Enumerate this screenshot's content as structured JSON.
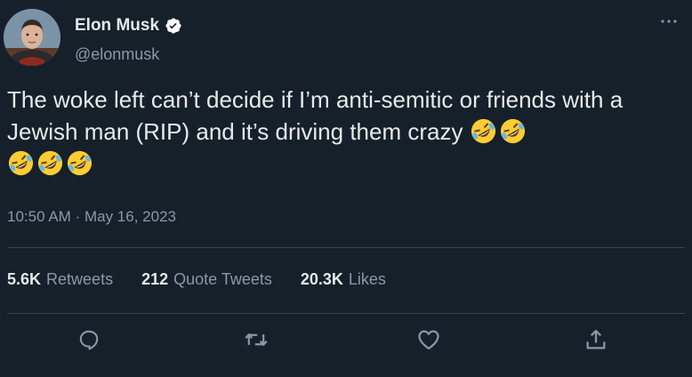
{
  "author": {
    "display_name": "Elon Musk",
    "handle": "@elonmusk",
    "verified": true
  },
  "tweet": {
    "text": "The woke left can’t decide if I’m anti-semitic or friends with a Jewish man (RIP) and it’s driving them crazy",
    "emojis": [
      "rolling-on-floor-laughing",
      "rolling-on-floor-laughing",
      "rolling-on-floor-laughing",
      "rolling-on-floor-laughing",
      "rolling-on-floor-laughing"
    ],
    "time": "10:50 AM",
    "separator": "·",
    "date": "May 16, 2023"
  },
  "stats": {
    "retweets": {
      "value": "5.6K",
      "label": "Retweets"
    },
    "quotes": {
      "value": "212",
      "label": "Quote Tweets"
    },
    "likes": {
      "value": "20.3K",
      "label": "Likes"
    }
  },
  "actions": {
    "reply": "reply-icon",
    "retweet": "retweet-icon",
    "like": "heart-icon",
    "share": "share-icon"
  },
  "colors": {
    "background": "#15202b",
    "text": "#e7e9ea",
    "secondary": "#8b98a5",
    "divider": "#38444d",
    "verified": "#ffffff"
  }
}
